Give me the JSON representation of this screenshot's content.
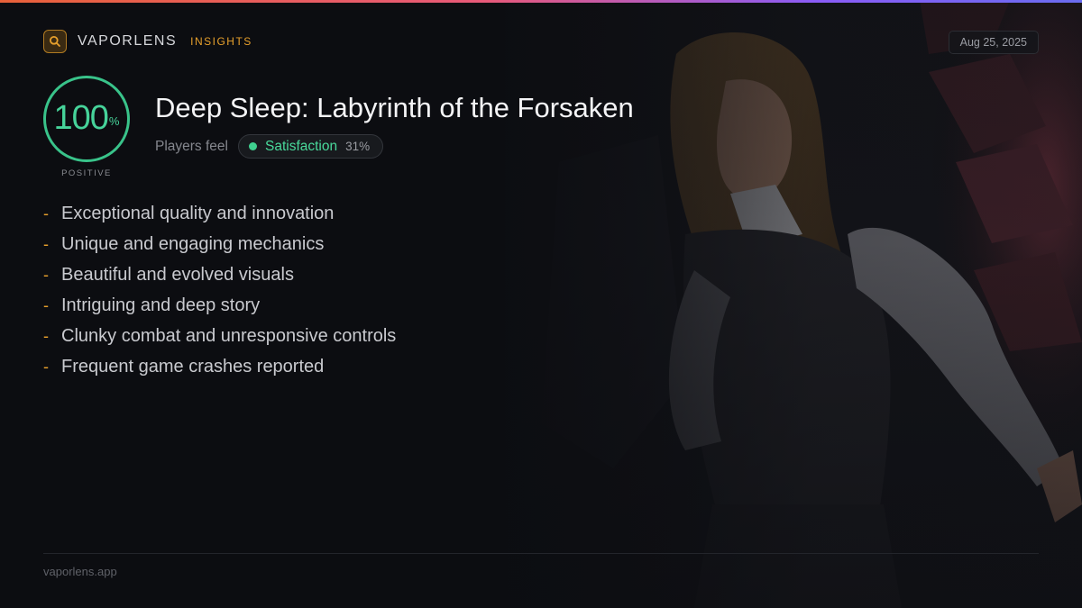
{
  "top_bar": {
    "colors": [
      "#e8613a",
      "#e85a7a",
      "#8b5cf6",
      "#6a6cf0"
    ]
  },
  "header": {
    "brand_icon": "search-icon",
    "brand_name": "VAPORLENS",
    "brand_tag": "INSIGHTS",
    "date": "Aug 25, 2025"
  },
  "score": {
    "value": "100",
    "unit": "%",
    "label": "POSITIVE",
    "color": "#39c38a"
  },
  "game": {
    "title": "Deep Sleep: Labyrinth of the Forsaken"
  },
  "sentiment": {
    "prefix": "Players feel",
    "name": "Satisfaction",
    "percent": "31%",
    "color": "#3fd08f"
  },
  "points": [
    {
      "bullet": "-",
      "text": "Exceptional quality and innovation"
    },
    {
      "bullet": "-",
      "text": "Unique and engaging mechanics"
    },
    {
      "bullet": "-",
      "text": "Beautiful and evolved visuals"
    },
    {
      "bullet": "-",
      "text": "Intriguing and deep story"
    },
    {
      "bullet": "-",
      "text": "Clunky combat and unresponsive controls"
    },
    {
      "bullet": "-",
      "text": "Frequent game crashes reported"
    }
  ],
  "footer": {
    "url": "vaporlens.app"
  },
  "colors": {
    "accent": "#e7a02c",
    "positive": "#39c38a",
    "background": "#0c0d11"
  }
}
